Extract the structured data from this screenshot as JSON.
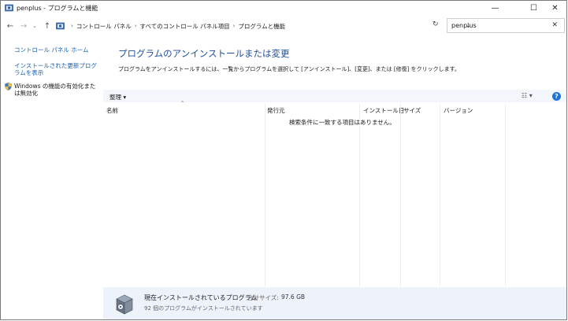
{
  "window": {
    "title": "penplus - プログラムと機能",
    "controls": {
      "minimize": "—",
      "maximize": "☐",
      "close": "✕"
    }
  },
  "navigation": {
    "back": "←",
    "forward": "→",
    "recent": "⌄",
    "up": "↑",
    "breadcrumbs": [
      "コントロール パネル",
      "すべてのコントロール パネル項目",
      "プログラムと機能"
    ],
    "separator": "›",
    "dropdown": "⌄",
    "refresh": "↻"
  },
  "search": {
    "value": "penplus",
    "clear": "✕"
  },
  "sidebar": {
    "home": "コントロール パネル ホーム",
    "updates": "インストールされた更新プログラムを表示",
    "features": "Windows の機能の有効化または無効化"
  },
  "main": {
    "title": "プログラムのアンインストールまたは変更",
    "description": "プログラムをアンインストールするには、一覧からプログラムを選択して [アンインストール]、[変更]、または [修復] をクリックします。"
  },
  "toolbar": {
    "organize": "整理 ▾",
    "view": "☷ ▾",
    "help": "?"
  },
  "columns": {
    "sort_indicator": "^",
    "name": "名前",
    "publisher": "発行元",
    "install_date": "インストール日",
    "size": "サイズ",
    "version": "バージョン"
  },
  "list": {
    "empty_message": "検索条件に一致する項目はありません。"
  },
  "details": {
    "title": "現在インストールされているプログラム",
    "size_label": "合計サイズ:",
    "size_value": "97.6 GB",
    "count": "92 個のプログラムがインストールされています"
  },
  "colors": {
    "link": "#1a5fb4",
    "heading": "#1e4e9a",
    "toolbar_bg": "#f3f6fb",
    "details_bg": "#eef3fb",
    "help": "#1b73d9"
  }
}
